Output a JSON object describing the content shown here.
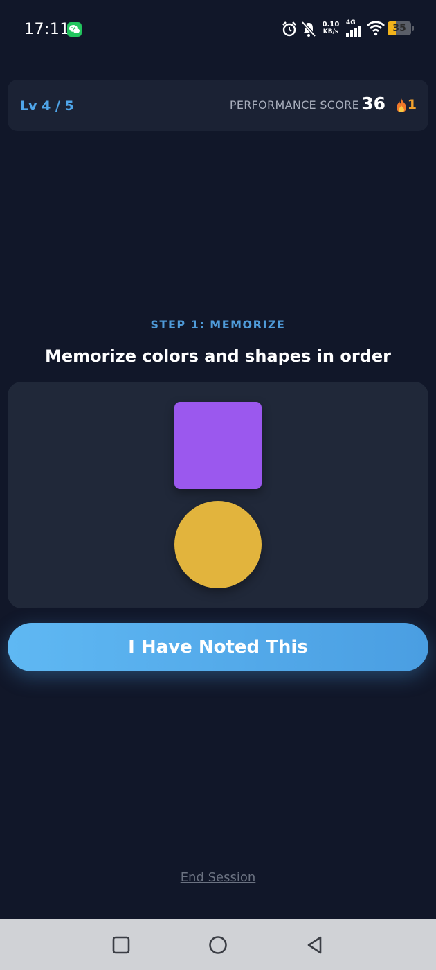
{
  "status_bar": {
    "time": "17:11",
    "net_speed_value": "0.10",
    "net_speed_unit": "KB/s",
    "network_type": "4G",
    "battery_level": "35",
    "battery_fraction": 0.35,
    "icons": [
      "wechat-icon",
      "alarm-icon",
      "mute-bell-icon",
      "signal-icon",
      "wifi-icon",
      "battery-icon"
    ]
  },
  "header": {
    "level": "Lv 4 / 5",
    "performance_label": "PERFORMANCE SCORE",
    "performance_score": "36",
    "streak_icon": "flame-icon",
    "streak_count": "1"
  },
  "main": {
    "step_label": "STEP 1: MEMORIZE",
    "instruction": "Memorize colors and shapes in order",
    "sequence": [
      {
        "shape": "square",
        "color": "#9b58ee"
      },
      {
        "shape": "circle",
        "color": "#e2b43d"
      }
    ],
    "confirm_button": "I Have Noted This",
    "end_session": "End Session"
  },
  "nav_bar": {
    "buttons": [
      "recents-icon",
      "home-icon",
      "back-icon"
    ]
  },
  "colors": {
    "background": "#111729",
    "card": "#1b2234",
    "panel": "#202839",
    "accent": "#4fa6ea",
    "streak": "#f2a12d"
  }
}
